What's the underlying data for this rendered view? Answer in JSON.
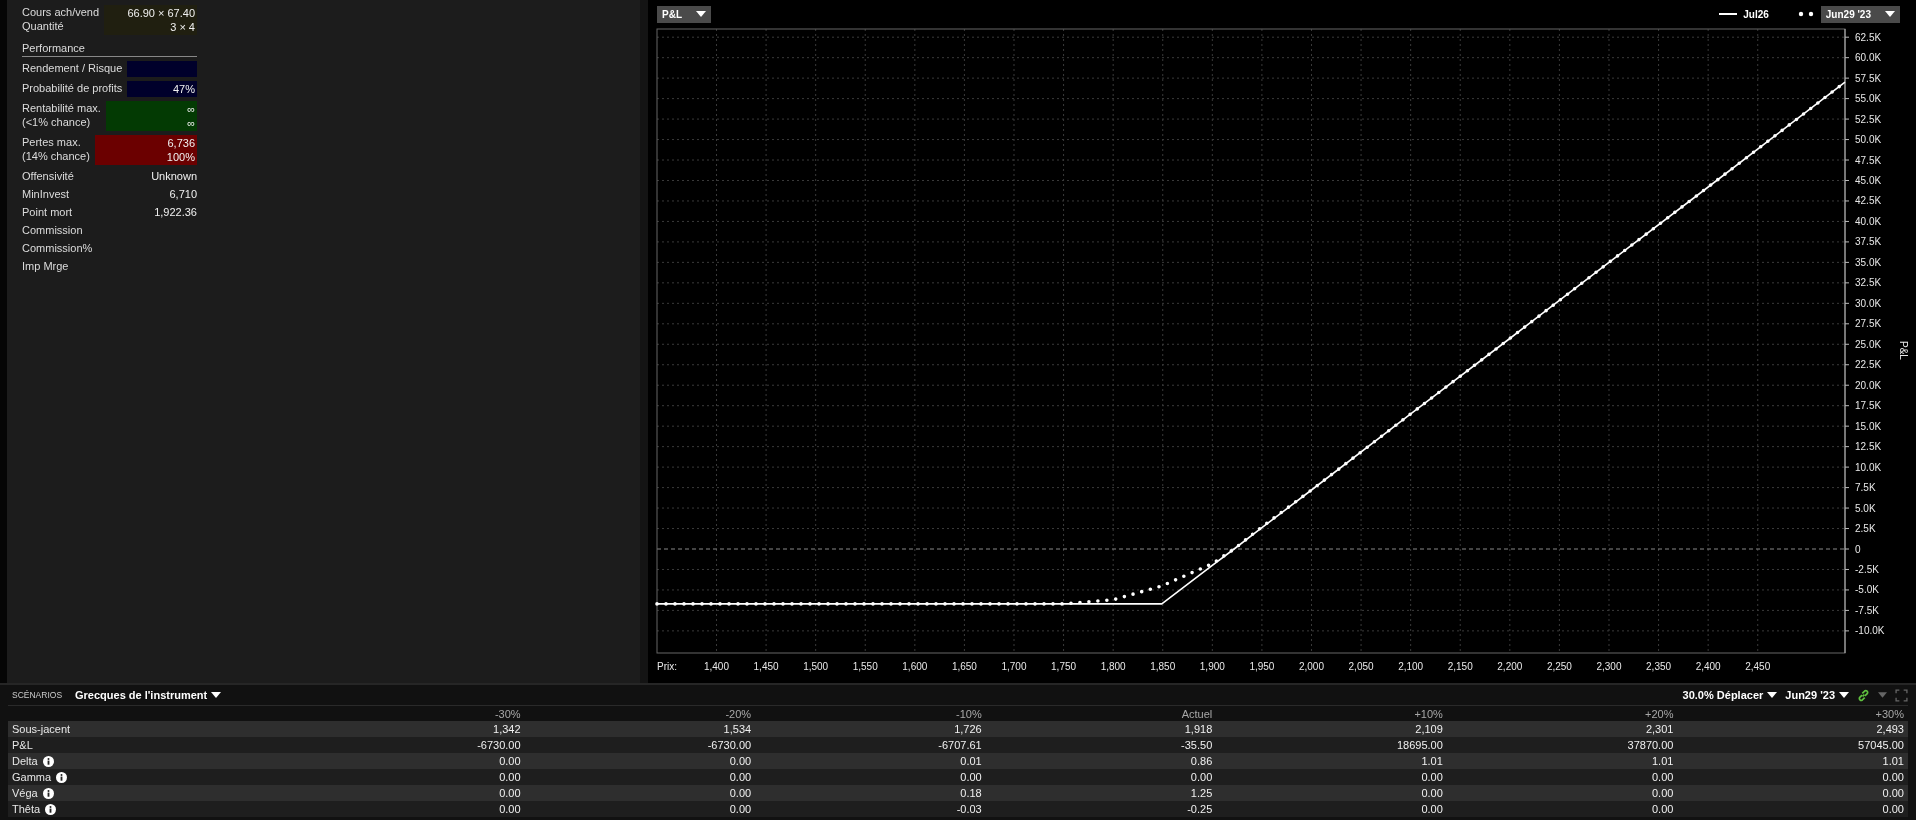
{
  "summary": {
    "groups": [
      {
        "color": "#201f10",
        "lines": [
          {
            "label": "Cours ach/vend",
            "value": "66.90 × 67.40"
          },
          {
            "label": "Quantité",
            "value": "3 × 4"
          }
        ]
      }
    ]
  },
  "performance": {
    "title": "Performance",
    "groups": [
      {
        "color": "#00002b",
        "lines": [
          {
            "label": "Rendement / Risque"
          }
        ]
      },
      {
        "color": "#00002b",
        "lines": [
          {
            "label": "Probabilité de profits",
            "value": "47%"
          }
        ]
      },
      {
        "color": "#033a03",
        "lines": [
          {
            "label": "Rentabilité max.",
            "value": "∞"
          },
          {
            "label": "(<1% chance)",
            "value": "∞"
          }
        ]
      },
      {
        "color": "#6b0000",
        "lines": [
          {
            "label": "Pertes max.",
            "value": "6,736"
          },
          {
            "label": "(14% chance)",
            "value": "100%"
          }
        ]
      },
      {
        "lines": [
          {
            "label": "Offensivité",
            "value": "Unknown"
          }
        ]
      },
      {
        "lines": [
          {
            "label": "MinInvest",
            "value": "6,710"
          }
        ]
      },
      {
        "lines": [
          {
            "label": "Point mort",
            "value": "1,922.36"
          }
        ]
      },
      {
        "lines": [
          {
            "label": "Commission"
          }
        ]
      },
      {
        "lines": [
          {
            "label": "Commission%"
          }
        ]
      },
      {
        "lines": [
          {
            "label": "Imp Mrge"
          }
        ]
      }
    ]
  },
  "chart": {
    "metric_dropdown": "P&L",
    "chart_data": {
      "type": "line",
      "xlabel": "Prix:",
      "ylabel": "P&L",
      "xlim": [
        1340,
        2538
      ],
      "ylim": [
        -12700,
        63500
      ],
      "x": [
        1340,
        1700,
        1750,
        1800,
        1849,
        1900,
        1922,
        1950,
        2000,
        2100,
        2200,
        2300,
        2400,
        2538
      ],
      "series": [
        {
          "name": "Jul26",
          "color": "#ffffff",
          "line_style": "solid",
          "values": [
            -6700,
            -6700,
            -6700,
            -6700,
            -6700,
            -2000,
            0,
            2600,
            7200,
            16500,
            25700,
            35000,
            44200,
            57000
          ]
        },
        {
          "name": "Jun29 '23",
          "color": "#ffffff",
          "line_style": "dotted",
          "values": [
            -6700,
            -6700,
            -6700,
            -6200,
            -4500,
            -1800,
            0,
            2700,
            7200,
            16500,
            25700,
            35000,
            44200,
            57000
          ]
        }
      ],
      "grid": true,
      "ref_lines": [
        {
          "axis": "y",
          "value": 0
        }
      ],
      "xticks": [
        {
          "value": 1400,
          "label": "1,400"
        },
        {
          "value": 1450,
          "label": "1,450"
        },
        {
          "value": 1500,
          "label": "1,500"
        },
        {
          "value": 1550,
          "label": "1,550"
        },
        {
          "value": 1600,
          "label": "1,600"
        },
        {
          "value": 1650,
          "label": "1,650"
        },
        {
          "value": 1700,
          "label": "1,700"
        },
        {
          "value": 1750,
          "label": "1,750"
        },
        {
          "value": 1800,
          "label": "1,800"
        },
        {
          "value": 1850,
          "label": "1,850"
        },
        {
          "value": 1900,
          "label": "1,900"
        },
        {
          "value": 1950,
          "label": "1,950"
        },
        {
          "value": 2000,
          "label": "2,000"
        },
        {
          "value": 2050,
          "label": "2,050"
        },
        {
          "value": 2100,
          "label": "2,100"
        },
        {
          "value": 2150,
          "label": "2,150"
        },
        {
          "value": 2200,
          "label": "2,200"
        },
        {
          "value": 2250,
          "label": "2,250"
        },
        {
          "value": 2300,
          "label": "2,300"
        },
        {
          "value": 2350,
          "label": "2,350"
        },
        {
          "value": 2400,
          "label": "2,400"
        },
        {
          "value": 2450,
          "label": "2,450"
        }
      ],
      "yticks": [
        {
          "value": 62500,
          "label": "62.5K"
        },
        {
          "value": 60000,
          "label": "60.0K"
        },
        {
          "value": 57500,
          "label": "57.5K"
        },
        {
          "value": 55000,
          "label": "55.0K"
        },
        {
          "value": 52500,
          "label": "52.5K"
        },
        {
          "value": 50000,
          "label": "50.0K"
        },
        {
          "value": 47500,
          "label": "47.5K"
        },
        {
          "value": 45000,
          "label": "45.0K"
        },
        {
          "value": 42500,
          "label": "42.5K"
        },
        {
          "value": 40000,
          "label": "40.0K"
        },
        {
          "value": 37500,
          "label": "37.5K"
        },
        {
          "value": 35000,
          "label": "35.0K"
        },
        {
          "value": 32500,
          "label": "32.5K"
        },
        {
          "value": 30000,
          "label": "30.0K"
        },
        {
          "value": 27500,
          "label": "27.5K"
        },
        {
          "value": 25000,
          "label": "25.0K"
        },
        {
          "value": 22500,
          "label": "22.5K"
        },
        {
          "value": 20000,
          "label": "20.0K"
        },
        {
          "value": 17500,
          "label": "17.5K"
        },
        {
          "value": 15000,
          "label": "15.0K"
        },
        {
          "value": 12500,
          "label": "12.5K"
        },
        {
          "value": 10000,
          "label": "10.0K"
        },
        {
          "value": 7500,
          "label": "7.5K"
        },
        {
          "value": 5000,
          "label": "5.0K"
        },
        {
          "value": 2500,
          "label": "2.5K"
        },
        {
          "value": 0,
          "label": "0"
        },
        {
          "value": -2500,
          "label": "-2.5K"
        },
        {
          "value": -5000,
          "label": "-5.0K"
        },
        {
          "value": -7500,
          "label": "-7.5K"
        },
        {
          "value": -10000,
          "label": "-10.0K"
        }
      ]
    }
  },
  "scenarios": {
    "title": "SCÉNARIOS",
    "view_dropdown": "Grecques de l'instrument",
    "shift_dropdown": "30.0% Déplacer",
    "date_dropdown": "Jun29 '23",
    "columns": [
      "-30%",
      "-20%",
      "-10%",
      "Actuel",
      "+10%",
      "+20%",
      "+30%"
    ],
    "rows": [
      {
        "label": "Sous-jacent",
        "info": false,
        "values": [
          "1,342",
          "1,534",
          "1,726",
          "1,918",
          "2,109",
          "2,301",
          "2,493"
        ]
      },
      {
        "label": "P&L",
        "info": false,
        "values": [
          "-6730.00",
          "-6730.00",
          "-6707.61",
          "-35.50",
          "18695.00",
          "37870.00",
          "57045.00"
        ]
      },
      {
        "label": "Delta",
        "info": true,
        "values": [
          "0.00",
          "0.00",
          "0.01",
          "0.86",
          "1.01",
          "1.01",
          "1.01"
        ]
      },
      {
        "label": "Gamma",
        "info": true,
        "values": [
          "0.00",
          "0.00",
          "0.00",
          "0.00",
          "0.00",
          "0.00",
          "0.00"
        ]
      },
      {
        "label": "Véga",
        "info": true,
        "values": [
          "0.00",
          "0.00",
          "0.18",
          "1.25",
          "0.00",
          "0.00",
          "0.00"
        ]
      },
      {
        "label": "Thêta",
        "info": true,
        "values": [
          "0.00",
          "0.00",
          "-0.03",
          "-0.25",
          "0.00",
          "0.00",
          "0.00"
        ]
      }
    ]
  }
}
